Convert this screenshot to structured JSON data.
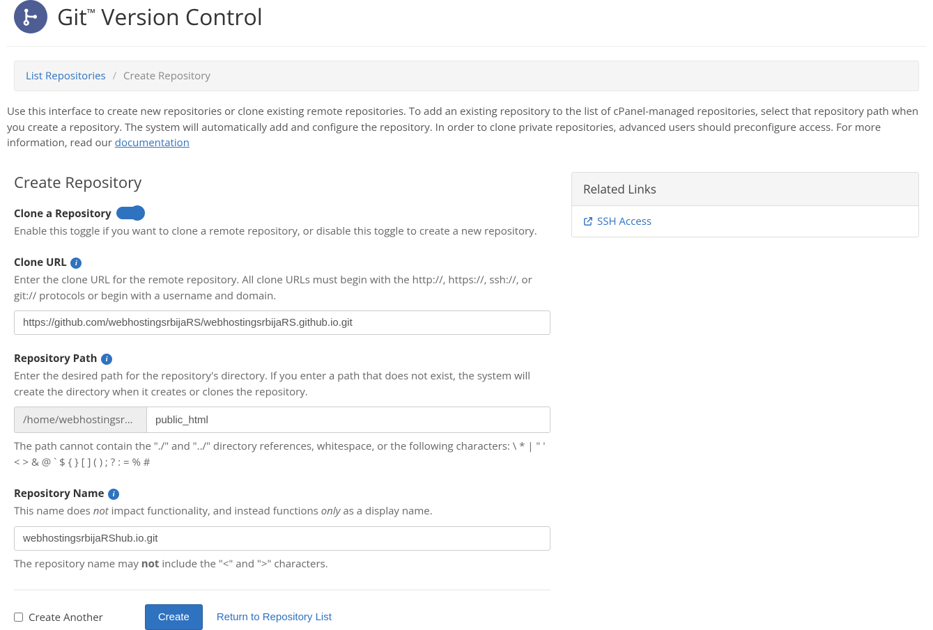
{
  "header": {
    "title_pre": "Git",
    "title_tm": "™",
    "title_post": " Version Control"
  },
  "breadcrumb": {
    "list_label": "List Repositories",
    "current": "Create Repository"
  },
  "intro": {
    "text": "Use this interface to create new repositories or clone existing remote repositories. To add an existing repository to the list of cPanel-managed repositories, select that repository path when you create a repository. The system will automatically add and configure the repository. In order to clone private repositories, advanced users should preconfigure access. For more information, read our ",
    "doc_link": "documentation"
  },
  "form": {
    "section_title": "Create Repository",
    "clone": {
      "label": "Clone a Repository",
      "help": "Enable this toggle if you want to clone a remote repository, or disable this toggle to create a new repository.",
      "on": true
    },
    "clone_url": {
      "label": "Clone URL",
      "help": "Enter the clone URL for the remote repository. All clone URLs must begin with the http://, https://, ssh://, or git:// protocols or begin with a username and domain.",
      "value": "https://github.com/webhostingsrbijaRS/webhostingsrbijaRS.github.io.git"
    },
    "repo_path": {
      "label": "Repository Path",
      "help": "Enter the desired path for the repository's directory. If you enter a path that does not exist, the system will create the directory when it creates or clones the repository.",
      "prefix": "/home/webhostingsr…",
      "value": "public_html",
      "hint": "The path cannot contain the \"./\" and \"../\" directory references, whitespace, or the following characters: \\ * | \" ' < > & @ ` $ { } [ ] ( ) ; ? : = % #"
    },
    "repo_name": {
      "label": "Repository Name",
      "help_pre": "This name does ",
      "help_not": "not",
      "help_mid": " impact functionality, and instead functions ",
      "help_only": "only",
      "help_post": " as a display name.",
      "value": "webhostingsrbijaRShub.io.git",
      "hint_pre": "The repository name may ",
      "hint_not": "not",
      "hint_post": " include the \"<\" and \">\" characters."
    },
    "actions": {
      "create_another": "Create Another",
      "create": "Create",
      "return": "Return to Repository List"
    }
  },
  "side": {
    "panel_title": "Related Links",
    "ssh_access": "SSH Access"
  }
}
